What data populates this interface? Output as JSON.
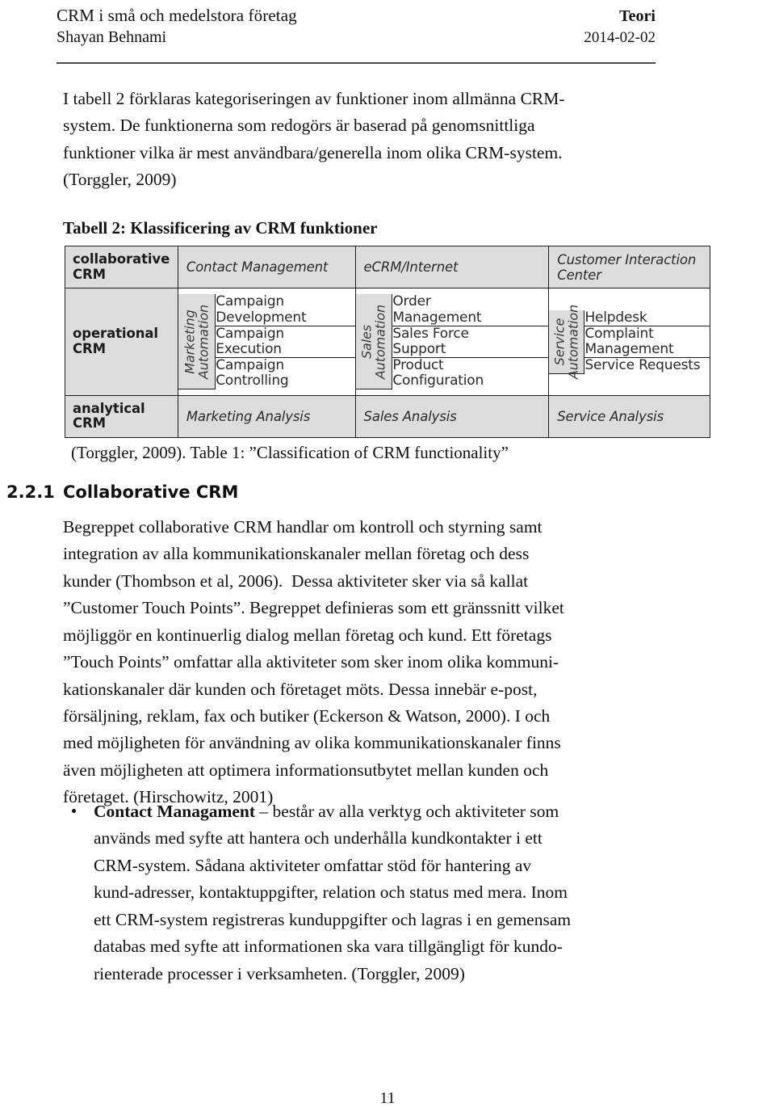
{
  "header": {
    "document_title": "CRM i små och medelstora företag",
    "section_label": "Teori",
    "author": "Shayan Behnami",
    "date": "2014-02-02"
  },
  "intro": {
    "lines": [
      "I tabell 2 förklaras kategoriseringen av funktioner inom allmänna CRM-",
      "system. De funktionerna som redogörs är baserad på genomsnittliga",
      "funktioner vilka är mest användbara/generella inom olika CRM-system.",
      "(Torggler, 2009)"
    ],
    "table_caption": "Tabell 2: Klassificering av CRM funktioner"
  },
  "figure": {
    "levels": {
      "collaborative": "collaborative\nCRM",
      "operational": "operational\nCRM",
      "analytical": "analytical\nCRM"
    },
    "columns": [
      {
        "collaborative": "Contact Management",
        "automation_label_line1": "Marketing",
        "automation_label_line2": "Automation",
        "functions": [
          "Campaign\nDevelopment",
          "Campaign\nExecution",
          "Campaign\nControlling"
        ],
        "analysis": "Marketing Analysis"
      },
      {
        "collaborative": "eCRM/Internet",
        "automation_label_line1": "Sales",
        "automation_label_line2": "Automation",
        "functions": [
          "Order\nManagement",
          "Sales Force\nSupport",
          "Product\nConfiguration"
        ],
        "analysis": "Sales Analysis"
      },
      {
        "collaborative": "Customer Interaction Center",
        "automation_label_line1": "Service",
        "automation_label_line2": "Automation",
        "functions": [
          "Helpdesk",
          "Complaint\nManagement",
          "Service Requests"
        ],
        "analysis": "Service Analysis"
      }
    ],
    "source_caption": "(Torggler, 2009). Table 1: ”Classification of CRM functionality”"
  },
  "section": {
    "number": "2.2.1",
    "title": "Collaborative CRM",
    "paragraph_lines": [
      "Begreppet collaborative CRM handlar om kontroll och styrning samt",
      "integration av alla kommunikationskanaler mellan företag och dess",
      "kunder (Thombson et al, 2006).  Dessa aktiviteter sker via så kallat",
      "”Customer Touch Points”. Begreppet definieras som ett gränssnitt vilket",
      "möjliggör en kontinuerlig dialog mellan företag och kund. Ett företags",
      "”Touch Points” omfattar alla aktiviteter som sker inom olika kommuni-",
      "kationskanaler där kunden och företaget möts. Dessa innebär e-post,",
      "försäljning, reklam, fax och butiker (Eckerson & Watson, 2000). I och",
      "med möjligheten för användning av olika kommunikationskanaler finns",
      "även möjligheten att optimera informationsutbytet mellan kunden och",
      "företaget. (Hirschowitz, 2001)"
    ]
  },
  "bullets": [
    {
      "term": "Contact Managament",
      "lines": [
        " – består av alla verktyg och aktiviteter som",
        "används med syfte att hantera och underhålla kundkontakter i ett",
        "CRM-system. Sådana aktiviteter omfattar stöd för hantering av",
        "kund-adresser, kontaktuppgifter, relation och status med mera. Inom",
        "ett CRM-system registreras kunduppgifter och lagras i en gemensam",
        "databas med syfte att informationen ska vara tillgängligt för kundo-",
        "rienterade processer i verksamheten. (Torggler, 2009)"
      ]
    }
  ],
  "footer": {
    "page_number": "11"
  }
}
